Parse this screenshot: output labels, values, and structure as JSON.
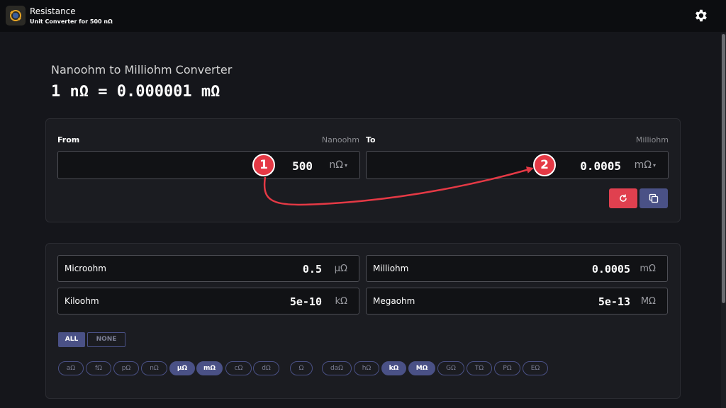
{
  "header": {
    "title": "Resistance",
    "subtitle": "Unit Converter for 500 nΩ"
  },
  "main": {
    "title": "Nanoohm to Milliohm Converter",
    "formula": "1 nΩ = 0.000001 mΩ"
  },
  "converter": {
    "from_label": "From",
    "from_unit_name": "Nanoohm",
    "from_value": "500",
    "from_unit": "nΩ",
    "to_label": "To",
    "to_unit_name": "Milliohm",
    "to_value": "0.0005",
    "to_unit": "mΩ",
    "caret": "▾"
  },
  "results": [
    {
      "name": "Microohm",
      "value": "0.5",
      "unit": "μΩ"
    },
    {
      "name": "Milliohm",
      "value": "0.0005",
      "unit": "mΩ"
    },
    {
      "name": "Kiloohm",
      "value": "5e-10",
      "unit": "kΩ"
    },
    {
      "name": "Megaohm",
      "value": "5e-13",
      "unit": "MΩ"
    }
  ],
  "filters": {
    "all": "ALL",
    "none": "NONE"
  },
  "chips": [
    {
      "label": "aΩ",
      "on": false
    },
    {
      "label": "fΩ",
      "on": false
    },
    {
      "label": "pΩ",
      "on": false
    },
    {
      "label": "nΩ",
      "on": false
    },
    {
      "label": "μΩ",
      "on": true
    },
    {
      "label": "mΩ",
      "on": true
    },
    {
      "label": "cΩ",
      "on": false
    },
    {
      "label": "dΩ",
      "on": false
    },
    {
      "label": "Ω",
      "on": false
    },
    {
      "label": "daΩ",
      "on": false
    },
    {
      "label": "hΩ",
      "on": false
    },
    {
      "label": "kΩ",
      "on": true
    },
    {
      "label": "MΩ",
      "on": true
    },
    {
      "label": "GΩ",
      "on": false
    },
    {
      "label": "TΩ",
      "on": false
    },
    {
      "label": "PΩ",
      "on": false
    },
    {
      "label": "EΩ",
      "on": false
    }
  ],
  "annotations": {
    "badge1": "1",
    "badge2": "2",
    "arrow_color": "#e53945"
  },
  "icons": {
    "app": "refresh-coin-icon",
    "settings": "gear-icon",
    "reset": "reset-icon",
    "copy": "copy-icon"
  },
  "colors": {
    "accent": "#4a5186",
    "danger": "#e0404f"
  }
}
